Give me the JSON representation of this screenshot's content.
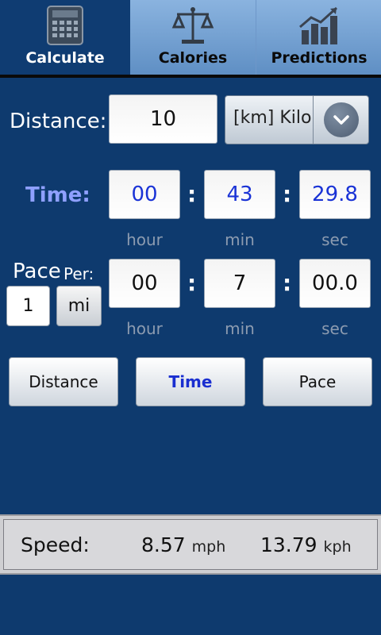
{
  "tabs": [
    {
      "label": "Calculate",
      "icon": "calculator-icon",
      "active": true
    },
    {
      "label": "Calories",
      "icon": "scale-icon",
      "active": false
    },
    {
      "label": "Predictions",
      "icon": "bar-chart-icon",
      "active": false
    }
  ],
  "distance": {
    "label": "Distance:",
    "value": "10",
    "unit_selected": "[km] Kilometers"
  },
  "time": {
    "label": "Time:",
    "hour": "00",
    "min": "43",
    "sec": "29.8"
  },
  "pace": {
    "label": "Pace",
    "per_label": "Per:",
    "per_value": "1",
    "per_unit": "mi",
    "hour": "00",
    "min": "7",
    "sec": "00.0"
  },
  "sublabels": {
    "hour": "hour",
    "min": "min",
    "sec": "sec"
  },
  "separator": ":",
  "actions": {
    "distance": "Distance",
    "time": "Time",
    "pace": "Pace"
  },
  "speed": {
    "label": "Speed:",
    "mph_value": "8.57",
    "mph_unit": "mph",
    "kph_value": "13.79",
    "kph_unit": "kph"
  },
  "colors": {
    "background": "#0e3a6e",
    "time_label": "#8fa0ff",
    "field_value_blue": "#1a33d6"
  }
}
